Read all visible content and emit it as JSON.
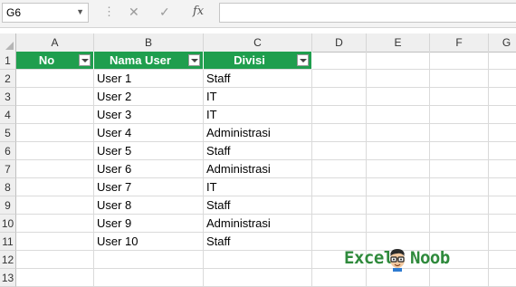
{
  "formula_bar": {
    "name_box": "G6",
    "cancel_icon": "✕",
    "enter_icon": "✓",
    "fx_label": "fx",
    "formula": ""
  },
  "columns": [
    "A",
    "B",
    "C",
    "D",
    "E",
    "F",
    "G"
  ],
  "rows": [
    "1",
    "2",
    "3",
    "4",
    "5",
    "6",
    "7",
    "8",
    "9",
    "10",
    "11",
    "12",
    "13"
  ],
  "table": {
    "headers": [
      "No",
      "Nama User",
      "Divisi"
    ],
    "header_color": "#1f9e4e",
    "rows": [
      {
        "no": "",
        "user": "User 1",
        "divisi": "Staff"
      },
      {
        "no": "",
        "user": "User 2",
        "divisi": "IT"
      },
      {
        "no": "",
        "user": "User 3",
        "divisi": "IT"
      },
      {
        "no": "",
        "user": "User 4",
        "divisi": "Administrasi"
      },
      {
        "no": "",
        "user": "User 5",
        "divisi": "Staff"
      },
      {
        "no": "",
        "user": "User 6",
        "divisi": "Administrasi"
      },
      {
        "no": "",
        "user": "User 7",
        "divisi": "IT"
      },
      {
        "no": "",
        "user": "User 8",
        "divisi": "Staff"
      },
      {
        "no": "",
        "user": "User 9",
        "divisi": "Administrasi"
      },
      {
        "no": "",
        "user": "User 10",
        "divisi": "Staff"
      }
    ]
  },
  "logo": {
    "word1": "Excel",
    "word2": "Noob",
    "accent": "#2f8a3c"
  }
}
